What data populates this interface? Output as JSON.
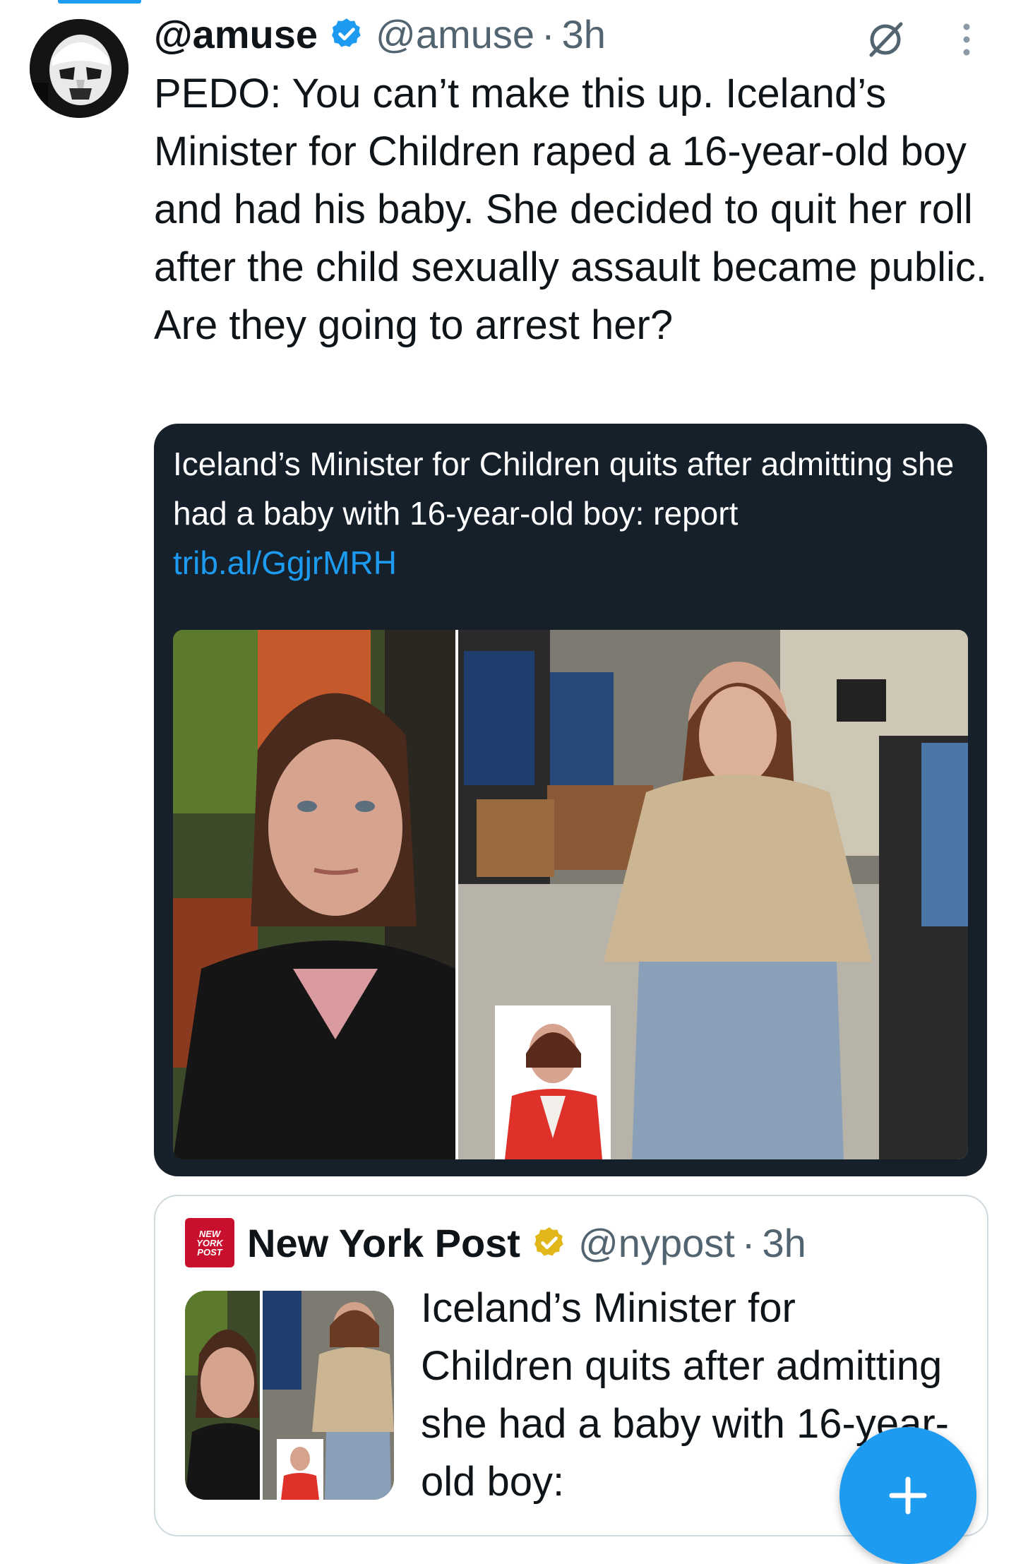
{
  "tweet": {
    "author_name": "@amuse",
    "author_handle": "@amuse",
    "separator": "·",
    "time": "3h",
    "text": "PEDO: You can’t make this up. Iceland’s Minister for Children raped a 16-year-old boy and had his baby. She decided to quit her roll after the child sexually assault became public. Are they going to arrest her?"
  },
  "media_card": {
    "text": "Iceland’s Minister for Children quits after admitting she had a baby with 16-year-old boy: report",
    "link": "trib.al/GgjrMRH"
  },
  "quoted_tweet": {
    "logo_lines": [
      "NEW",
      "YORK",
      "POST"
    ],
    "author_name": "New York Post",
    "author_handle": "@nypost",
    "separator": "·",
    "time": "3h",
    "text": "Iceland’s Minister for Children quits after admitting she had a baby with 16-year-old boy:"
  },
  "fab": {
    "label": "+"
  },
  "colors": {
    "accent": "#1d9bf0",
    "card_background": "#15202b",
    "gold_verified": "#e2b719",
    "nypost_red": "#c8102e",
    "secondary_text": "#536471"
  },
  "icons": {
    "verified": "verified-badge-icon",
    "grok": "grok-icon",
    "more": "more-vertical-icon",
    "gold_verified": "gold-verified-badge-icon",
    "compose": "plus-icon"
  }
}
